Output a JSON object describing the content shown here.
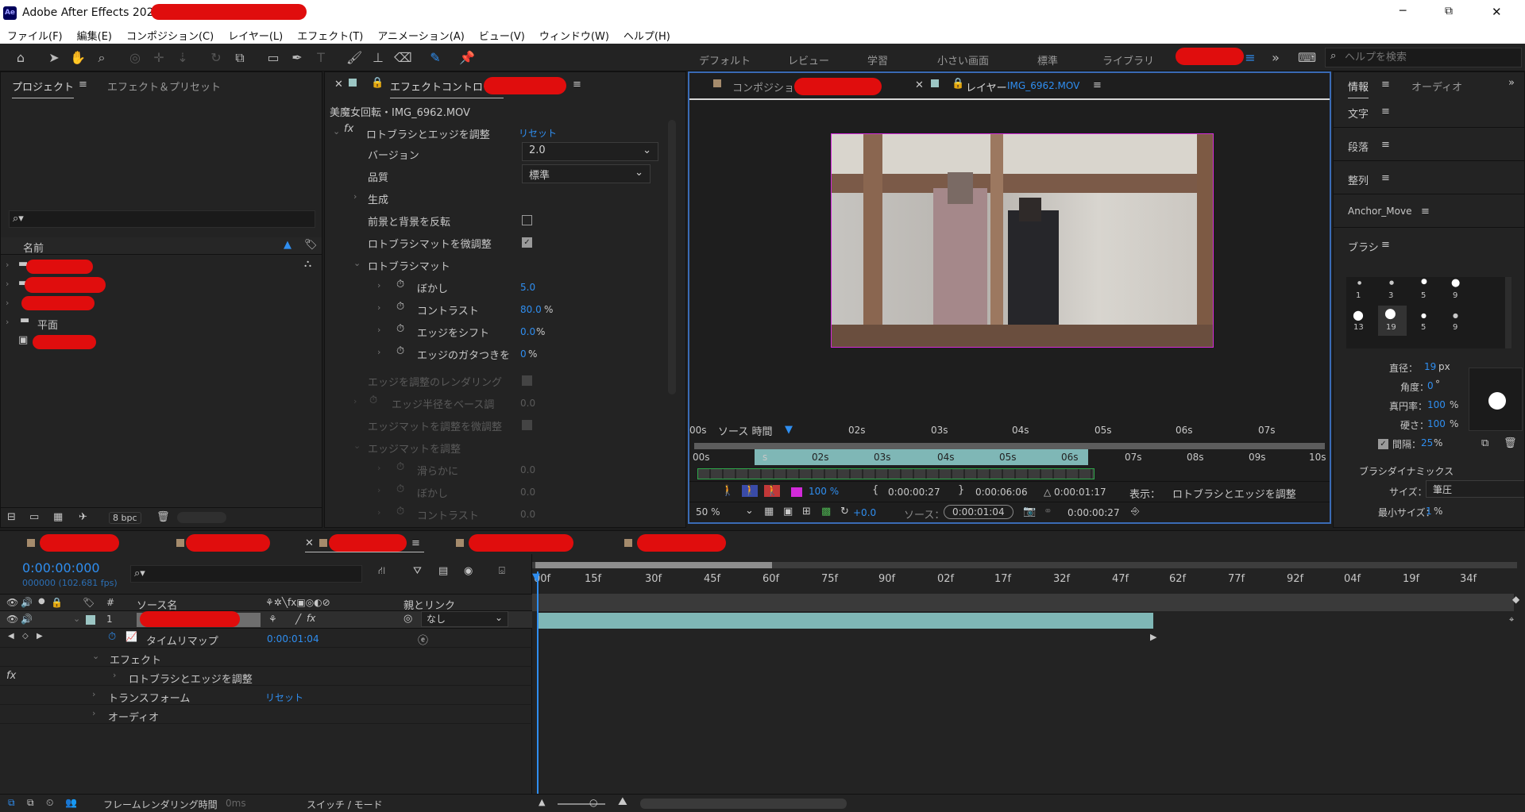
{
  "window": {
    "title": "Adobe After Effects 2023",
    "controls": {
      "minimize": "─",
      "maximize": "⧉",
      "close": "✕"
    }
  },
  "menu": [
    "ファイル(F)",
    "編集(E)",
    "コンポジション(C)",
    "レイヤー(L)",
    "エフェクト(T)",
    "アニメーション(A)",
    "ビュー(V)",
    "ウィンドウ(W)",
    "ヘルプ(H)"
  ],
  "workspaces": [
    "デフォルト",
    "レビュー",
    "学習",
    "小さい画面",
    "標準",
    "ライブラリ"
  ],
  "search_help": {
    "placeholder": "ヘルプを検索"
  },
  "project_panel": {
    "tabs": [
      "プロジェクト",
      "エフェクト＆プリセット"
    ],
    "column_name": "名前",
    "items": [
      {
        "label": ""
      },
      {
        "label": ""
      },
      {
        "label": ""
      },
      {
        "label": "平面"
      },
      {
        "label": ""
      }
    ],
    "bpc": "8 bpc"
  },
  "effect_controls": {
    "tab": "エフェクトコントロール",
    "subtitle": "美魔女回転・IMG_6962.MOV",
    "effect_name": "ロトブラシとエッジを調整",
    "reset": "リセット",
    "version_label": "バージョン",
    "version_value": "2.0",
    "quality_label": "品質",
    "quality_value": "標準",
    "generate": "生成",
    "invert_fg_bg": "前景と背景を反転",
    "fine_tune": "ロトブラシマットを微調整",
    "roto_matte": "ロトブラシマット",
    "feather": "ぼかし",
    "feather_val": "5.0",
    "contrast": "コントラスト",
    "contrast_val": "80.0",
    "contrast_unit": "%",
    "shift_edge": "エッジをシフト",
    "shift_edge_val": "0.0",
    "shift_edge_unit": "%",
    "chatter": "エッジのガタつきを",
    "chatter_val": "0",
    "chatter_unit": "%",
    "render_edge": "エッジを調整のレンダリング",
    "base_radius": "エッジ半径をベース調",
    "base_radius_val": "0.0",
    "fine_tune_edge": "エッジマットを調整を微調整",
    "edge_matte": "エッジマットを調整",
    "smooth": "滑らかに",
    "smooth_val": "0.0",
    "feather2": "ぼかし",
    "feather2_val": "0.0",
    "contrast2": "コントラスト",
    "contrast2_val": "0.0"
  },
  "viewer": {
    "tab_comp": "コンポジション",
    "tab_layer": "レイヤー",
    "tab_layer_file": "IMG_6962.MOV",
    "source_time_label": "ソース 時間",
    "ruler_top": [
      "00s",
      "02s",
      "03s",
      "04s",
      "05s",
      "06s",
      "07s"
    ],
    "ruler_bottom": [
      "00s",
      "s",
      "02s",
      "03s",
      "04s",
      "05s",
      "06s",
      "07s",
      "08s",
      "09s",
      "10s"
    ],
    "zoom_pct": "100 %",
    "in_time": "0:00:00:27",
    "out_time": "0:00:06:06",
    "duration": "△ 0:00:01:17",
    "display_label": "表示：",
    "display_value": "ロトブラシとエッジを調整",
    "zoom": "50 %",
    "exposure": "+0.0",
    "source_label": "ソース：",
    "source_time": "0:00:01:04",
    "current": "0:00:00:27"
  },
  "right_panel": {
    "tabs": [
      "情報",
      "オーディオ"
    ],
    "sections": [
      "文字",
      "段落",
      "整列",
      "Anchor_Move",
      "ブラシ"
    ],
    "brush_sizes": [
      "1",
      "3",
      "5",
      "9",
      "13",
      "19",
      "5",
      "9"
    ],
    "diameter_label": "直径：",
    "diameter": "19",
    "diameter_unit": "px",
    "angle_label": "角度：",
    "angle": "0",
    "angle_unit": "°",
    "roundness_label": "真円率：",
    "roundness": "100",
    "roundness_unit": "%",
    "hardness_label": "硬さ：",
    "hardness": "100",
    "hardness_unit": "%",
    "spacing_label": "間隔：",
    "spacing": "25",
    "spacing_unit": "%",
    "dynamics": "ブラシダイナミックス",
    "size_label": "サイズ：",
    "size_value": "筆圧",
    "min_size_label": "最小サイズ：",
    "min_size": "1",
    "min_size_unit": "%"
  },
  "timeline": {
    "timecode": "0:00:00:000",
    "frames_fps": "000000 (102.681 fps)",
    "col_source": "ソース名",
    "col_parent": "親とリンク",
    "col_num": "#",
    "layer_num": "1",
    "parent_value": "なし",
    "time_remap": "タイムリマップ",
    "time_remap_val": "0:00:01:04",
    "effects": "エフェクト",
    "effect_item": "ロトブラシとエッジを調整",
    "transform": "トランスフォーム",
    "reset": "リセット",
    "audio": "オーディオ",
    "ruler": [
      "00f",
      "15f",
      "30f",
      "45f",
      "60f",
      "75f",
      "90f",
      "02f",
      "17f",
      "32f",
      "47f",
      "62f",
      "77f",
      "92f",
      "04f",
      "19f",
      "34f"
    ],
    "footer_left": "フレームレンダリング時間",
    "footer_ms": "0ms",
    "switch_mode": "スイッチ / モード"
  },
  "colors": {
    "accent": "#2f8ef0",
    "redact": "#e00d0d",
    "teal": "#7fb7b6",
    "magenta": "#d22ad9"
  }
}
